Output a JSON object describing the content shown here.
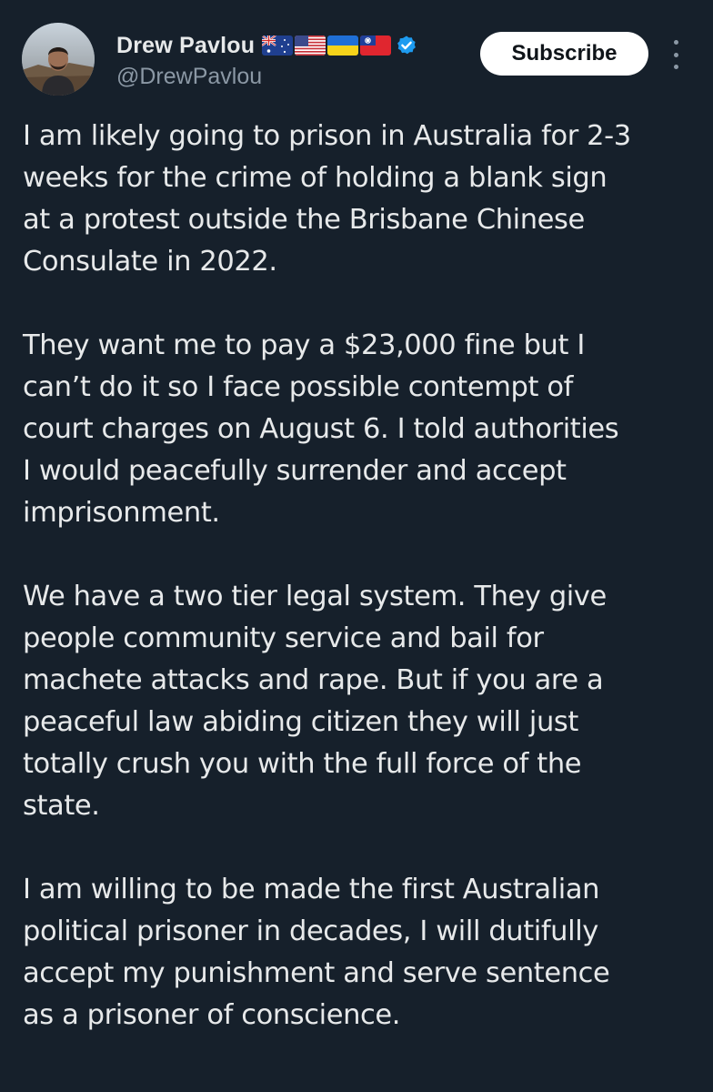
{
  "author": {
    "display_name": "Drew Pavlou",
    "handle": "@DrewPavlou",
    "flags": [
      "australia-flag",
      "usa-flag",
      "ukraine-flag",
      "taiwan-flag"
    ],
    "verified": true
  },
  "actions": {
    "subscribe_label": "Subscribe",
    "more_icon": "more-vertical-icon"
  },
  "tweet": {
    "paragraphs": [
      {
        "lines": [
          "I am likely going to prison in Australia for 2-3",
          "weeks for the crime of holding a blank sign",
          "at a protest outside the Brisbane Chinese",
          "Consulate in 2022."
        ]
      },
      {
        "lines": [
          "They want me to pay a $23,000 fine but I",
          "can’t do it so I face possible contempt of",
          "court charges on August 6. I told authorities",
          "I would peacefully surrender and accept",
          "imprisonment."
        ]
      },
      {
        "lines": [
          "We have a two tier legal system. They give",
          "people community service and bail for",
          "machete attacks and rape. But if you are a",
          "peaceful law abiding citizen they will just",
          "totally crush you with the full force of the",
          "state."
        ]
      },
      {
        "lines": [
          "I am willing to be made the first Australian",
          "political prisoner in decades, I will dutifully",
          "accept my punishment and serve sentence",
          "as a prisoner of conscience."
        ]
      }
    ]
  },
  "colors": {
    "background": "#16202b",
    "text_primary": "#e7e9ea",
    "text_secondary": "#8b98a5",
    "verified_blue": "#1d9bf0",
    "button_bg": "#ffffff",
    "button_text": "#0f1419"
  }
}
